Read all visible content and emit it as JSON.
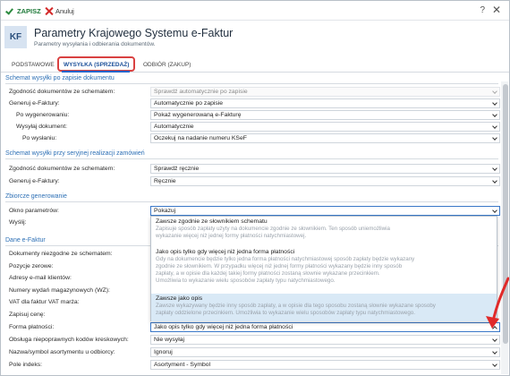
{
  "toolbar": {
    "save_label": "ZAPISZ",
    "cancel_label": "Anuluj",
    "help_label": "?",
    "close_label": "✕"
  },
  "header": {
    "logo_text": "KF",
    "title": "Parametry Krajowego Systemu e-Faktur",
    "subtitle": "Parametry wysyłania i odbierania dokumentów."
  },
  "tabs": [
    {
      "label": "PODSTAWOWE"
    },
    {
      "label": "WYSYŁKA (SPRZEDAŻ)",
      "active": true
    },
    {
      "label": "ODBIÓR (ZAKUP)"
    }
  ],
  "sections": {
    "s1": "Schemat wysyłki po zapisie dokumentu",
    "s2": "Schemat wysyłki przy seryjnej realizacji zamówień",
    "s3": "Zbiorcze generowanie",
    "s4": "Dane e-Faktur"
  },
  "form": {
    "s1_zgodnosc_label": "Zgodność dokumentów ze schematem:",
    "s1_zgodnosc_value": "Sprawdź automatycznie po zapisie",
    "s1_generuj_label": "Generuj e-Faktury:",
    "s1_generuj_value": "Automatycznie po zapisie",
    "po_wygenerowaniu_label": "Po wygenerowaniu:",
    "po_wygenerowaniu_value": "Pokaż wygenerowaną e-Fakturę",
    "wysylaj_label": "Wysyłaj dokument:",
    "wysylaj_value": "Automatycznie",
    "po_wyslaniu_label": "Po wysłaniu:",
    "po_wyslaniu_value": "Oczekuj na nadanie numeru KSeF",
    "s2_zgodnosc_label": "Zgodność dokumentów ze schematem:",
    "s2_zgodnosc_value": "Sprawdź ręcznie",
    "s2_generuj_label": "Generuj e-Faktury:",
    "s2_generuj_value": "Ręcznie",
    "okno_label": "Okno parametrów:",
    "okno_value": "Pokazuj",
    "wyslij_label": "Wyślij:",
    "dokumenty_niezgodne_label": "Dokumenty niezgodne ze schematem:",
    "pozycje_zerowe_label": "Pozycje zerowe:",
    "adresy_label": "Adresy e-mail klientów:",
    "numery_label": "Numery wydań magazynowych (WZ):",
    "vat_label": "VAT dla faktur VAT marża:",
    "zapisuj_label": "Zapisuj cenę:",
    "forma_label": "Forma płatności:",
    "forma_value": "Jako opis tylko gdy więcej niż jedna forma płatności",
    "obsluga_label": "Obsługa niepoprawnych kodów kreskowych:",
    "obsluga_value": "Nie wysyłaj",
    "nazwa_label": "Nazwa/symbol asortymentu u odbiorcy:",
    "nazwa_value": "Ignoruj",
    "pole_label": "Pole indeks:",
    "pole_value": "Asortyment - Symbol"
  },
  "dropdown": {
    "options": [
      {
        "title": "Zawsze zgodnie ze słownikiem schematu",
        "desc1": "Zapisuje sposób zapłaty użyty na dokumencie zgodnie ze słownikiem. Ten sposób uniemożliwia",
        "desc2": "wykazanie więcej niż jednej formy płatności natychmiastowej.",
        "desc3": "",
        "desc4": ""
      },
      {
        "title": "Jako opis tylko gdy więcej niż jedna forma płatności",
        "desc1": "Gdy na dokumencie będzie tylko jedna forma płatności natychmiastowej sposób zapłaty będzie wykazany",
        "desc2": "zgodnie ze słownikiem. W przypadku więcej niż jednej formy płatności wykazany będzie inny sposób",
        "desc3": "zapłaty, a w opisie dla każdej takiej formy płatności zostaną słownie wykazane przecinkiem.",
        "desc4": "Umożliwia to wykazanie wielu sposobów zapłaty typu natychmiastowego."
      },
      {
        "title": "Zawsze jako opis",
        "desc1": "Zawsze wykazywany będzie inny sposób zapłaty, a w opisie dla tego sposobu zostaną słownie wykazane sposoby",
        "desc2": "zapłaty oddzielone przecinkiem. Umożliwia to wykazanie wielu sposobów zapłaty typu natychmiastowego.",
        "desc3": "",
        "desc4": "",
        "selected": true
      }
    ]
  },
  "icons": [
    "check-icon",
    "close-x-icon",
    "help-icon",
    "window-close-icon",
    "chevron-down-icon",
    "chevron-up-icon",
    "annotation-arrow-icon"
  ],
  "colors": {
    "accent": "#2c6fb5",
    "tab_highlight": "#d94141",
    "selected_option": "#d9e9f6",
    "arrow": "#e02a2a"
  }
}
